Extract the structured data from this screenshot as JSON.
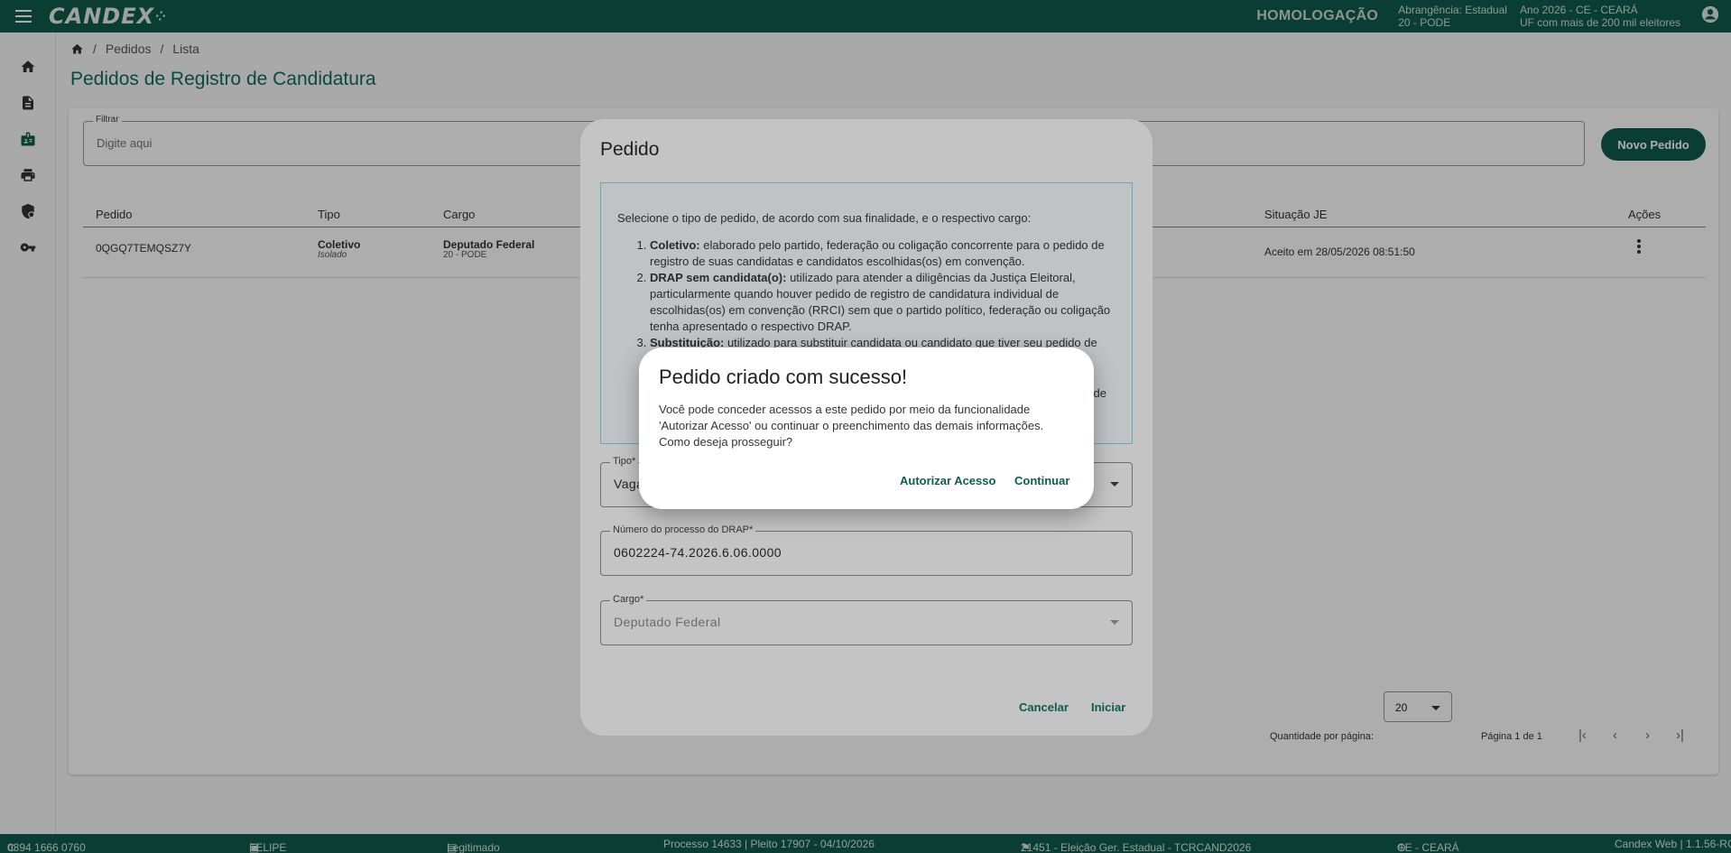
{
  "header": {
    "logo": "CANDEX",
    "env": "HOMOLOGAÇÃO",
    "abrangencia_line1": "Abrangência: Estadual",
    "abrangencia_line2": "20 - PODE",
    "ano_line1": "Ano 2026 - CE - CEARÁ",
    "ano_line2": "UF com mais de 200 mil eleitores"
  },
  "sidebar": {
    "items": [
      {
        "icon": "home-icon"
      },
      {
        "icon": "document-icon"
      },
      {
        "icon": "badge-icon",
        "active": true
      },
      {
        "icon": "printer-icon"
      },
      {
        "icon": "shield-icon"
      },
      {
        "icon": "key-icon"
      }
    ]
  },
  "breadcrumb": {
    "items": [
      "Pedidos",
      "Lista"
    ]
  },
  "page": {
    "title": "Pedidos de Registro de Candidatura"
  },
  "filter": {
    "label": "Filtrar",
    "placeholder": "Digite aqui"
  },
  "buttons": {
    "novo_pedido": "Novo Pedido"
  },
  "table": {
    "headers": [
      "Pedido",
      "Tipo",
      "Cargo",
      "Situação JE",
      "Ações"
    ],
    "rows": [
      {
        "pedido": "0QGQ7TEMQSZ7Y",
        "tipo": "Coletivo",
        "tipo_sub": "Isolado",
        "cargo": "Deputado Federal",
        "cargo_sub": "20 - PODE",
        "situacao": "Aceito em 28/05/2026 08:51:50"
      }
    ]
  },
  "pagination": {
    "per_page_label": "Quantidade por página:",
    "per_page_value": "20",
    "page_info": "Página 1 de 1"
  },
  "footer": {
    "phone": "0394 1666 0760",
    "user": "FELIPE",
    "status": "Legitimado",
    "processo": "Processo 14633 | Pleito 17907 - 04/10/2026",
    "eleicao": "21451 - Eleição Ger. Estadual - TCRCAND2026",
    "uf": "CE - CEARÁ",
    "version": "Candex Web | 1.1.56-RC"
  },
  "dialog": {
    "title": "Pedido",
    "intro": "Selecione o tipo de pedido, de acordo com sua finalidade, e o respectivo cargo:",
    "items": [
      {
        "term": "Coletivo:",
        "text": " elaborado pelo partido, federação ou coligação concorrente para o pedido de registro de suas candidatas e candidatos escolhidas(os) em convenção."
      },
      {
        "term": "DRAP sem candidata(o):",
        "text": " utilizado para atender a diligências da Justiça Eleitoral, particularmente quando houver pedido de registro de candidatura individual de escolhidas(os) em convenção (RRCI) sem que o partido político, federação ou coligação tenha apresentado o respectivo DRAP."
      },
      {
        "term": "Substituição:",
        "text": " utilizado para substituir candidata ou candidato que tiver seu pedido de"
      },
      {
        "term": "",
        "text": "de"
      }
    ],
    "tipo_label": "Tipo*",
    "tipo_value": "Vaga",
    "drap_label": "Número do processo do DRAP*",
    "drap_value": "0602224-74.2026.6.06.0000",
    "cargo_label": "Cargo*",
    "cargo_value": "Deputado Federal",
    "cancel": "Cancelar",
    "start": "Iniciar"
  },
  "success": {
    "title": "Pedido criado com sucesso!",
    "text": "Você pode conceder acessos a este pedido por meio da funcionalidade 'Autorizar Acesso' ou continuar o preenchimento das demais informações. Como deseja prosseguir?",
    "authorize": "Autorizar Acesso",
    "continue": "Continuar"
  }
}
